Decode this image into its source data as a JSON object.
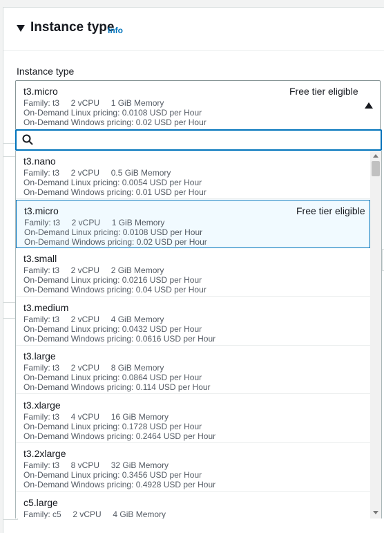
{
  "section": {
    "title": "Instance type",
    "info": "Info"
  },
  "field": {
    "label": "Instance type"
  },
  "selected": {
    "name": "t3.micro",
    "free_tier": "Free tier eligible",
    "meta_line": "Family: t3     2 vCPU     1 GiB Memory",
    "linux": "On-Demand Linux pricing: 0.0108 USD per Hour",
    "windows": "On-Demand Windows pricing: 0.02 USD per Hour"
  },
  "search": {
    "value": ""
  },
  "options": [
    {
      "name": "t3.nano",
      "free_tier": "",
      "meta_line": "Family: t3     2 vCPU     0.5 GiB Memory",
      "linux": "On-Demand Linux pricing: 0.0054 USD per Hour",
      "windows": "On-Demand Windows pricing: 0.01 USD per Hour"
    },
    {
      "name": "t3.micro",
      "free_tier": "Free tier eligible",
      "meta_line": "Family: t3     2 vCPU     1 GiB Memory",
      "linux": "On-Demand Linux pricing: 0.0108 USD per Hour",
      "windows": "On-Demand Windows pricing: 0.02 USD per Hour"
    },
    {
      "name": "t3.small",
      "free_tier": "",
      "meta_line": "Family: t3     2 vCPU     2 GiB Memory",
      "linux": "On-Demand Linux pricing: 0.0216 USD per Hour",
      "windows": "On-Demand Windows pricing: 0.04 USD per Hour"
    },
    {
      "name": "t3.medium",
      "free_tier": "",
      "meta_line": "Family: t3     2 vCPU     4 GiB Memory",
      "linux": "On-Demand Linux pricing: 0.0432 USD per Hour",
      "windows": "On-Demand Windows pricing: 0.0616 USD per Hour"
    },
    {
      "name": "t3.large",
      "free_tier": "",
      "meta_line": "Family: t3     2 vCPU     8 GiB Memory",
      "linux": "On-Demand Linux pricing: 0.0864 USD per Hour",
      "windows": "On-Demand Windows pricing: 0.114 USD per Hour"
    },
    {
      "name": "t3.xlarge",
      "free_tier": "",
      "meta_line": "Family: t3     4 vCPU     16 GiB Memory",
      "linux": "On-Demand Linux pricing: 0.1728 USD per Hour",
      "windows": "On-Demand Windows pricing: 0.2464 USD per Hour"
    },
    {
      "name": "t3.2xlarge",
      "free_tier": "",
      "meta_line": "Family: t3     8 vCPU     32 GiB Memory",
      "linux": "On-Demand Linux pricing: 0.3456 USD per Hour",
      "windows": "On-Demand Windows pricing: 0.4928 USD per Hour"
    },
    {
      "name": "c5.large",
      "free_tier": "",
      "meta_line": "Family: c5     2 vCPU     4 GiB Memory",
      "linux": "",
      "windows": ""
    }
  ]
}
